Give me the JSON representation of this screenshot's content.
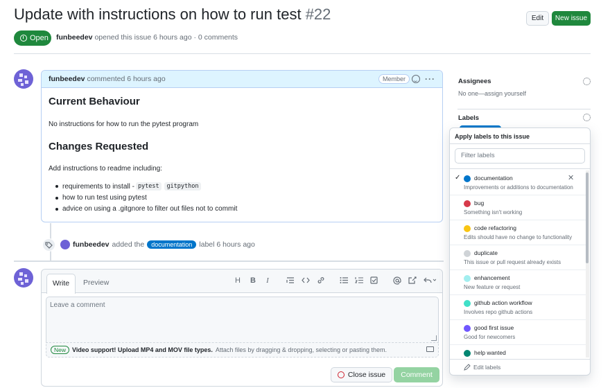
{
  "header": {
    "title": "Update with instructions on how to run test",
    "number": "#22",
    "edit_label": "Edit",
    "new_issue_label": "New issue",
    "state": "Open",
    "author": "funbeedev",
    "meta_text": "opened this issue 6 hours ago · 0 comments"
  },
  "comment": {
    "author": "funbeedev",
    "time": "commented 6 hours ago",
    "role": "Member",
    "heading1": "Current Behaviour",
    "para1": "No instructions for how to run the pytest program",
    "heading2": "Changes Requested",
    "para2": "Add instructions to readme including:",
    "bullets": [
      {
        "text": "requirements to install - ",
        "code1": "pytest",
        "code2": "gitpython"
      },
      {
        "text": "how to run test using pytest"
      },
      {
        "text": "advice on using a .gitgnore to filter out files not to commit"
      }
    ]
  },
  "event": {
    "author": "funbeedev",
    "pre": "added the",
    "label": "documentation",
    "post": "label 6 hours ago"
  },
  "composer": {
    "tab_write": "Write",
    "tab_preview": "Preview",
    "placeholder": "Leave a comment",
    "attach_new": "New",
    "attach_bold": "Video support! Upload MP4 and MOV file types.",
    "attach_rest": "Attach files by dragging & dropping, selecting or pasting them.",
    "close_label": "Close issue",
    "comment_label": "Comment",
    "toolbar": {
      "heading": "H",
      "bold": "B",
      "italic": "I"
    }
  },
  "sidebar": {
    "assignees_title": "Assignees",
    "assignees_text": "No one—assign yourself",
    "labels_title": "Labels"
  },
  "label_menu": {
    "title": "Apply labels to this issue",
    "filter_placeholder": "Filter labels",
    "edit_labels": "Edit labels",
    "items": [
      {
        "name": "documentation",
        "desc": "Improvements or additions to documentation",
        "color": "#0075ca",
        "checked": true
      },
      {
        "name": "bug",
        "desc": "Something isn't working",
        "color": "#d73a4a",
        "checked": false
      },
      {
        "name": "code refactoring",
        "desc": "Edits should have no change to functionality",
        "color": "#f9c513",
        "checked": false
      },
      {
        "name": "duplicate",
        "desc": "This issue or pull request already exists",
        "color": "#cfd3d7",
        "checked": false
      },
      {
        "name": "enhancement",
        "desc": "New feature or request",
        "color": "#a2eeef",
        "checked": false
      },
      {
        "name": "github action workflow",
        "desc": "Involves repo github actions",
        "color": "#40e0c8",
        "checked": false
      },
      {
        "name": "good first issue",
        "desc": "Good for newcomers",
        "color": "#7057ff",
        "checked": false
      },
      {
        "name": "help wanted",
        "desc": "",
        "color": "#008672",
        "checked": false
      }
    ]
  }
}
